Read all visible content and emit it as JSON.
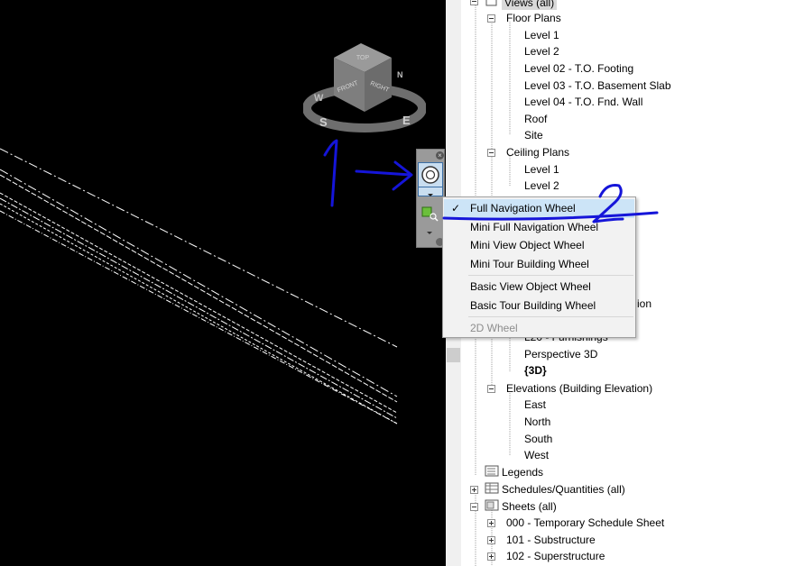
{
  "viewport": {
    "viewcube": {
      "top_label": "TOP",
      "front_label": "FRONT",
      "right_label": "RIGHT",
      "compass_labels": [
        "W",
        "S",
        "E",
        "N"
      ]
    }
  },
  "navigation_bar": {
    "active_tool_icon": "steering-wheel-icon",
    "second_tool_icon": "zoom-region-icon"
  },
  "dropdown_menu": {
    "items": [
      {
        "label": "Full Navigation Wheel",
        "checked": true,
        "enabled": true
      },
      {
        "label": "Mini Full Navigation Wheel",
        "checked": false,
        "enabled": true
      },
      {
        "label": "Mini View Object Wheel",
        "checked": false,
        "enabled": true
      },
      {
        "label": "Mini Tour Building Wheel",
        "checked": false,
        "enabled": true
      },
      {
        "label": "Basic View Object Wheel",
        "checked": false,
        "enabled": true
      },
      {
        "label": "Basic Tour Building Wheel",
        "checked": false,
        "enabled": true
      },
      {
        "label": "2D Wheel",
        "checked": false,
        "enabled": false
      }
    ],
    "check_glyph": "✓"
  },
  "project_browser": {
    "views_label": "Views (all)",
    "floor_plans": {
      "label": "Floor Plans",
      "items": [
        "Level 1",
        "Level 2",
        "Level 02 - T.O. Footing",
        "Level 03 - T.O. Basement Slab",
        "Level 04 - T.O. Fnd. Wall",
        "Roof",
        "Site"
      ]
    },
    "ceiling_plans": {
      "label": "Ceiling Plans",
      "items": [
        "Level 1",
        "Level 2"
      ]
    },
    "partial": {
      "elevation_tail": "ion",
      "l20_partial": "L20 - Furnishings"
    },
    "views_3d": [
      "Perspective 3D",
      "{3D}"
    ],
    "elevations": {
      "label": "Elevations (Building Elevation)",
      "items": [
        "East",
        "North",
        "South",
        "West"
      ]
    },
    "legends": "Legends",
    "schedules": "Schedules/Quantities (all)",
    "sheets": {
      "label": "Sheets (all)",
      "items": [
        "000 - Temporary Schedule Sheet",
        "101 - Substructure",
        "102 - Superstructure"
      ]
    }
  },
  "annotations": {
    "mark_1": "1",
    "mark_2": "2",
    "ink_color": "#1515d9"
  }
}
